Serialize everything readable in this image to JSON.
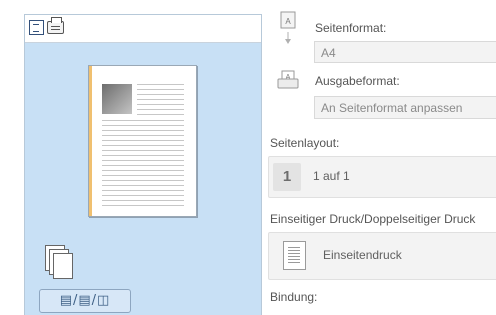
{
  "preview": {
    "icons": [
      "page-view-icon",
      "printer-view-icon",
      "page-stack-icon"
    ],
    "bottom_button_label": "▤/▤/◫"
  },
  "settings": {
    "page_format_label": "Seitenformat:",
    "page_format_value": "A4",
    "output_format_label": "Ausgabeformat:",
    "output_format_value": "An Seitenformat anpassen",
    "page_layout_label": "Seitenlayout:",
    "page_layout_number": "1",
    "page_layout_value": "1 auf 1",
    "duplex_label": "Einseitiger Druck/Doppelseitiger Druck",
    "duplex_value": "Einseitendruck",
    "binding_label": "Bindung:"
  },
  "colors": {
    "preview_bg": "#c8e0f5",
    "paper_edge": "#f0c070",
    "field_bg": "#f3f3f3"
  }
}
